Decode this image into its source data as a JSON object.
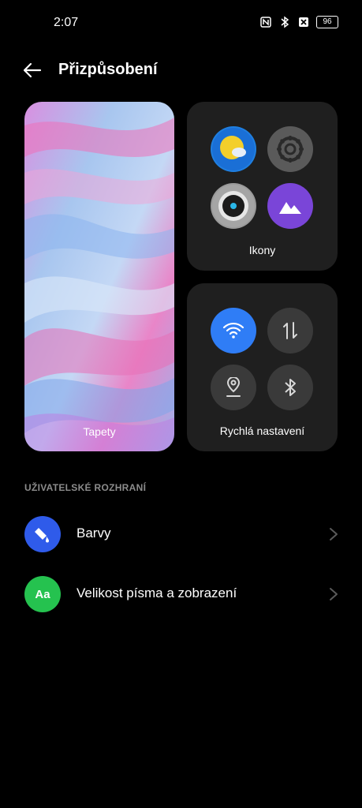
{
  "status_bar": {
    "time": "2:07",
    "battery": "96",
    "icons": [
      "nfc-icon",
      "bluetooth-icon",
      "no-sim-icon",
      "battery-icon"
    ]
  },
  "header": {
    "title": "Přizpůsobení",
    "back_icon": "arrow-left-icon"
  },
  "cards": {
    "wallpaper_label": "Tapety",
    "icons_label": "Ikony",
    "quick_settings_label": "Rychlá nastavení",
    "icon_samples": [
      "weather-icon",
      "settings-icon",
      "camera-icon",
      "gallery-icon"
    ],
    "quick_settings_samples": [
      "wifi-icon",
      "mobile-data-icon",
      "location-icon",
      "bluetooth-icon"
    ]
  },
  "section": {
    "title": "UŽIVATELSKÉ ROZHRANÍ",
    "items": [
      {
        "label": "Barvy",
        "icon": "paint-bucket-icon",
        "color": "#2f5bea"
      },
      {
        "label": "Velikost písma a zobrazení",
        "icon": "font-size-icon",
        "icon_text": "Aa",
        "color": "#25c24f"
      }
    ]
  },
  "colors": {
    "background": "#000000",
    "card": "#1f1f1f",
    "accent_blue": "#2f7df6",
    "muted": "#8c8c8c"
  }
}
